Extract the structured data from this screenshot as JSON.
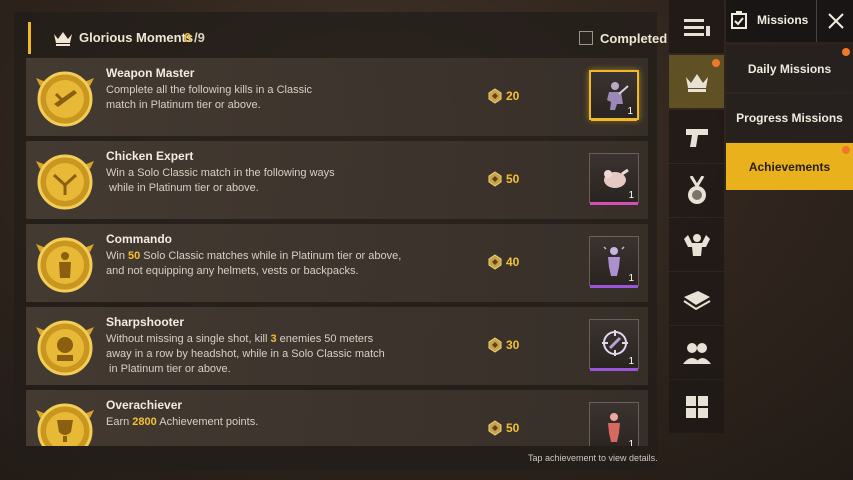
{
  "header": {
    "title": "Glorious Moments",
    "completed_count": "0",
    "total": "/9",
    "completed_filter_label": "Completed"
  },
  "achievements": [
    {
      "title": "Weapon Master",
      "desc_lines": [
        "Complete all the following kills in a Classic",
        "match in Platinum tier or above."
      ],
      "points": "20",
      "reward_count": "1",
      "rarity": "gold",
      "reward_icon": "soldier-kneeling-icon"
    },
    {
      "title": "Chicken Expert",
      "desc_lines": [
        "Win a Solo Classic match in the following ways",
        " while in Platinum tier or above."
      ],
      "points": "50",
      "reward_count": "1",
      "rarity": "pink",
      "reward_icon": "roast-chicken-icon"
    },
    {
      "title": "Commando",
      "desc_pre": "Win ",
      "desc_hl": "50",
      "desc_post": " Solo Classic matches while in Platinum tier or above,",
      "desc_line2": "and not equipping any helmets, vests or backpacks.",
      "points": "40",
      "reward_count": "1",
      "rarity": "purple",
      "reward_icon": "soldier-standing-icon"
    },
    {
      "title": "Sharpshooter",
      "desc_pre": "Without missing a single shot, kill ",
      "desc_hl": "3",
      "desc_post": " enemies 50 meters",
      "desc_line2": "away in a row by headshot, while in a Solo Classic match",
      "desc_line3": " in Platinum tier or above.",
      "points": "30",
      "reward_count": "1",
      "rarity": "purple",
      "reward_icon": "crosshair-emote-icon"
    },
    {
      "title": "Overachiever",
      "desc_pre": "Earn ",
      "desc_hl": "2800",
      "desc_post": " Achievement points.",
      "points": "50",
      "reward_count": "1",
      "rarity": "pink",
      "reward_icon": "soldier-red-icon"
    }
  ],
  "footer_hint": "Tap achievement to view details.",
  "icon_tabs": [
    {
      "icon": "menu-list-icon"
    },
    {
      "icon": "crown-icon",
      "active": true,
      "notification": true
    },
    {
      "icon": "pistol-icon"
    },
    {
      "icon": "medal-icon"
    },
    {
      "icon": "flex-muscle-icon"
    },
    {
      "icon": "vehicle-bridge-icon"
    },
    {
      "icon": "friends-icon"
    },
    {
      "icon": "grid-icon"
    }
  ],
  "nav": {
    "title": "Missions",
    "items": [
      {
        "label": "Daily Missions",
        "notification": true
      },
      {
        "label": "Progress Missions"
      },
      {
        "label": "Achievements",
        "active": true,
        "notification": true
      }
    ]
  },
  "colors": {
    "accent_gold": "#f1b82a",
    "highlight_text": "#f2c133",
    "notification_dot": "#f07826",
    "rarity_gold": "#f1b82a",
    "rarity_pink": "#d34fb5",
    "rarity_purple": "#9a55d8"
  }
}
